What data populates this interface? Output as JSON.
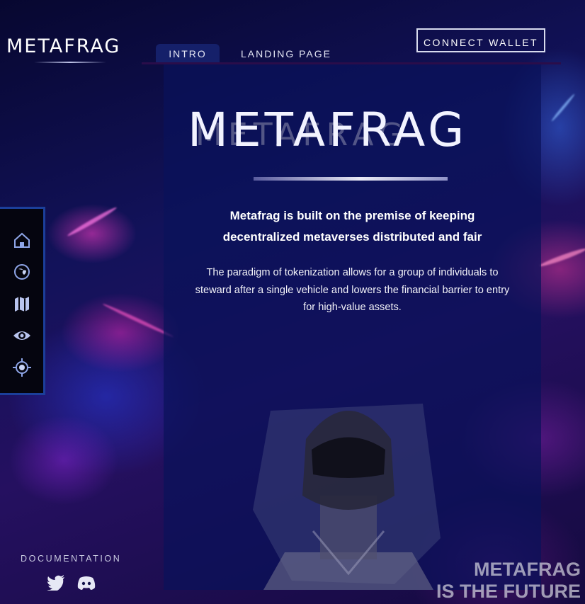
{
  "brand": {
    "logo_text": "METAFRAG"
  },
  "nav": {
    "tabs": [
      {
        "label": "INTRO",
        "active": true
      },
      {
        "label": "LANDING PAGE",
        "active": false
      }
    ],
    "connect_label": "CONNECT WALLET"
  },
  "hero": {
    "title": "METAFRAG",
    "lead": "Metafrag is built on the premise of keeping decentralized metaverses distributed and fair",
    "description": "The paradigm of tokenization allows for a group of individuals to steward after a single vehicle and lowers the financial barrier to entry for high-value assets."
  },
  "sidebar": {
    "icons": [
      "home-icon",
      "globe-icon",
      "map-icon",
      "eye-icon",
      "target-icon"
    ]
  },
  "footer": {
    "documentation_label": "DOCUMENTATION",
    "social_icons": [
      "twitter-icon",
      "discord-icon"
    ],
    "tagline_line1": "METAFRAG",
    "tagline_line2": "IS THE FUTURE"
  },
  "colors": {
    "accent_border": "#1b3f9a",
    "panel": "#0a125a",
    "text": "#ffffff"
  }
}
